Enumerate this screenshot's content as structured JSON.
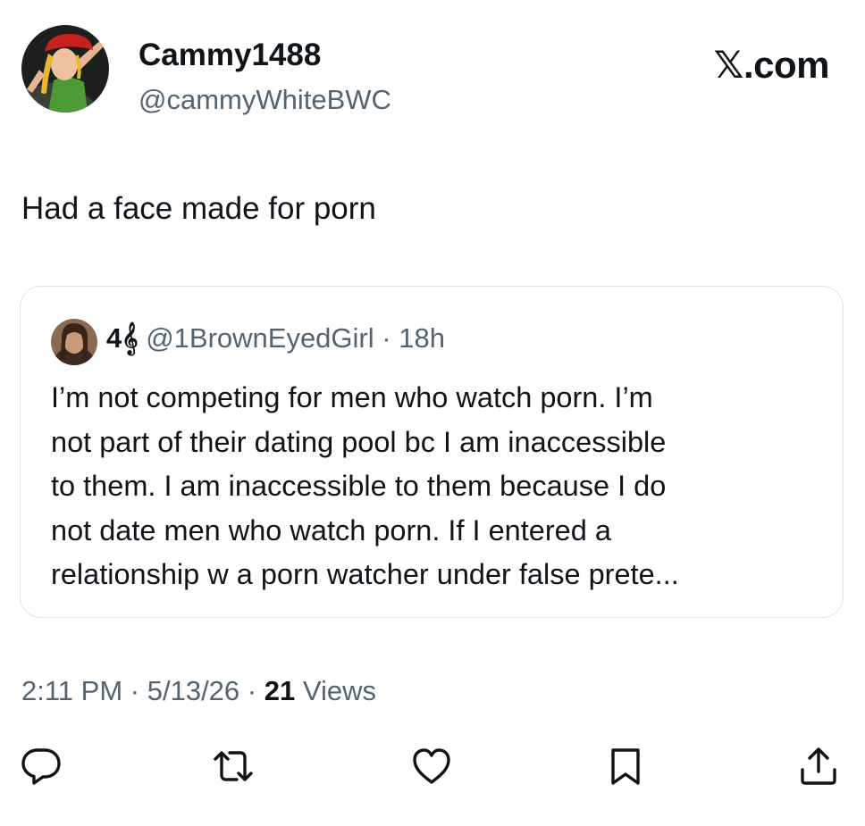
{
  "post": {
    "author": {
      "display_name": "Cammy1488",
      "handle": "@cammyWhiteBWC"
    },
    "brand": "𝕏.com",
    "text": "Had a face made for porn",
    "quoted": {
      "display_name": "4𝄞",
      "handle": "@1BrownEyedGirl",
      "separator": "·",
      "time": "18h",
      "text_lines": [
        "I’m not competing for men who watch porn. I’m",
        "not part of their dating pool bc I am inaccessible",
        "to them. I am inaccessible to them because I do",
        "not date men who watch porn. If I entered a",
        "relationship w a porn watcher under false prete..."
      ]
    },
    "meta": {
      "time": "2:11 PM",
      "sep1": "·",
      "date": "5/13/26",
      "sep2": "·",
      "views_count": "21",
      "views_label": "Views"
    }
  },
  "actions": [
    {
      "name": "reply-icon"
    },
    {
      "name": "repost-icon"
    },
    {
      "name": "like-icon"
    },
    {
      "name": "bookmark-icon"
    },
    {
      "name": "share-icon"
    }
  ],
  "colors": {
    "text_primary": "#0f1419",
    "text_secondary": "#536471",
    "border": "#dfe3e6",
    "avatar_background": "#1c1f1d",
    "avatar_hat": "#c8201e",
    "avatar_outfit": "#4e9a34",
    "avatar_hair": "#e8b832"
  }
}
